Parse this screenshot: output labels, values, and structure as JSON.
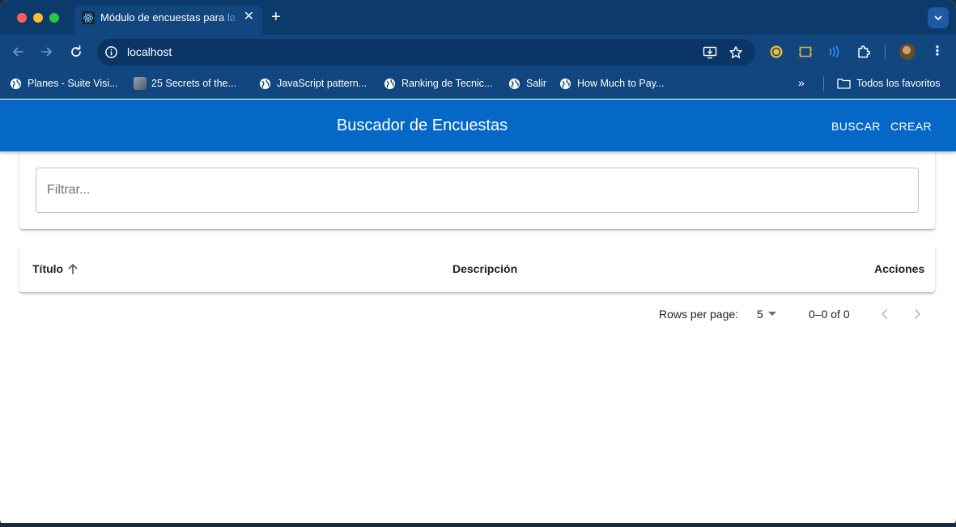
{
  "browser": {
    "tab_title": "Módulo de encuestas para la",
    "tab_close": "✕",
    "new_tab": "+",
    "url": "localhost",
    "menu": "⋮",
    "bookmarks": [
      {
        "label": "Planes - Suite Visi...",
        "icon": "globe-icon"
      },
      {
        "label": "25 Secrets of the...",
        "icon": "avatar-icon"
      },
      {
        "label": "JavaScript pattern...",
        "icon": "globe-icon"
      },
      {
        "label": "Ranking de Tecnic...",
        "icon": "globe-icon"
      },
      {
        "label": "Salir",
        "icon": "globe-icon"
      },
      {
        "label": "How Much to Pay...",
        "icon": "globe-icon"
      }
    ],
    "bookmarks_more": "»",
    "all_bookmarks": "Todos los favoritos"
  },
  "app": {
    "title": "Buscador de Encuestas",
    "buscar": "BUSCAR",
    "crear": "CREAR",
    "filter_placeholder": "Filtrar...",
    "columns": {
      "titulo": "Título",
      "descripcion": "Descripción",
      "acciones": "Acciones"
    },
    "pagination": {
      "rows_label": "Rows per page:",
      "rows_value": "5",
      "range": "0–0 of 0"
    }
  },
  "colors": {
    "appbar": "#0668c6",
    "browser_chrome": "#11467f",
    "tabstrip": "#0b3a6b"
  }
}
